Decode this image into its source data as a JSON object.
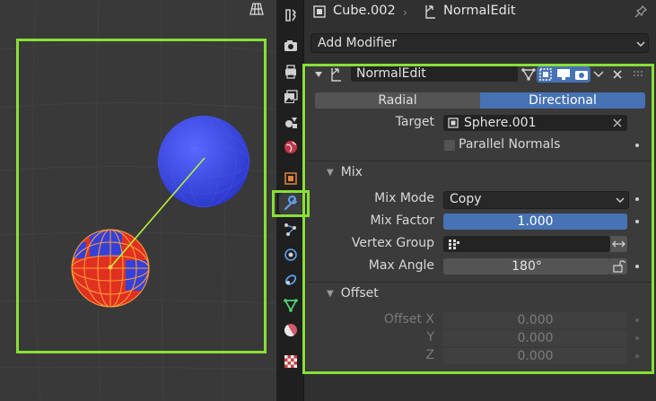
{
  "header": {
    "object_name": "Cube.002",
    "modifier_name": "NormalEdit"
  },
  "add_modifier": {
    "label": "Add Modifier"
  },
  "modifier": {
    "name": "NormalEdit",
    "mode_options": [
      "Radial",
      "Directional"
    ],
    "mode_selected": "Directional",
    "target": {
      "label": "Target",
      "value": "Sphere.001"
    },
    "parallel_normals": {
      "label": "Parallel Normals",
      "checked": false
    },
    "mix": {
      "title": "Mix",
      "mix_mode": {
        "label": "Mix Mode",
        "value": "Copy"
      },
      "mix_factor": {
        "label": "Mix Factor",
        "value": "1.000",
        "fill": 1.0
      },
      "vertex_group": {
        "label": "Vertex Group",
        "value": ""
      },
      "max_angle": {
        "label": "Max Angle",
        "value": "180°"
      }
    },
    "offset": {
      "title": "Offset",
      "x": {
        "label": "Offset X",
        "value": "0.000"
      },
      "y": {
        "label": "Y",
        "value": "0.000"
      },
      "z": {
        "label": "Z",
        "value": "0.000"
      }
    }
  },
  "tabs": [
    "tool",
    "render",
    "output",
    "view-layer",
    "scene",
    "world",
    "object",
    "modifiers",
    "particles",
    "physics",
    "constraints",
    "object-data",
    "material",
    "texture"
  ],
  "active_tab": "modifiers",
  "colors": {
    "highlight": "#88e036",
    "accent_blue": "#4772b3",
    "sphere_blue": "#3b49e6",
    "cube_red": "#e03020"
  }
}
